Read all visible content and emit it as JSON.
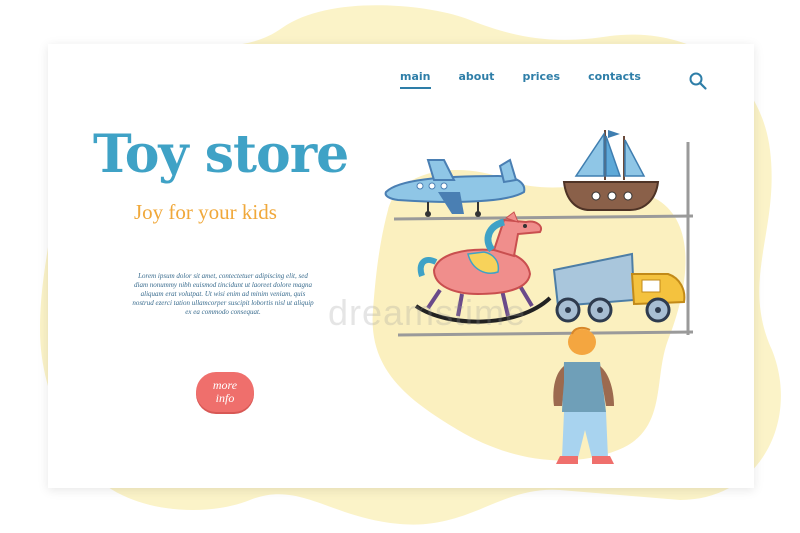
{
  "nav": {
    "items": [
      {
        "label": "main",
        "active": true
      },
      {
        "label": "about",
        "active": false
      },
      {
        "label": "prices",
        "active": false
      },
      {
        "label": "contacts",
        "active": false
      }
    ]
  },
  "hero": {
    "title": "Toy store",
    "subtitle": "Joy for your kids",
    "body": "Lorem ipsum dolor sit amet, contectetuer adipiscing elit, sed diam nonummy nibh euismod tincidunt ut laoreet dolore magna aliquam erat volutpat. Ut wisi enim ad minim veniam, quis nostrud ezerci tation ullamcorper suscipit lobortis nisl ut aliquip ex ea commodo consequat.",
    "button_label_line1": "more",
    "button_label_line2": "info"
  },
  "colors": {
    "accent": "#2e7ea8",
    "title": "#3fa2c6",
    "subtitle": "#f0a83a",
    "button": "#ef6f6c",
    "blob": "#fbf3c8"
  },
  "watermark": "dreamstime"
}
